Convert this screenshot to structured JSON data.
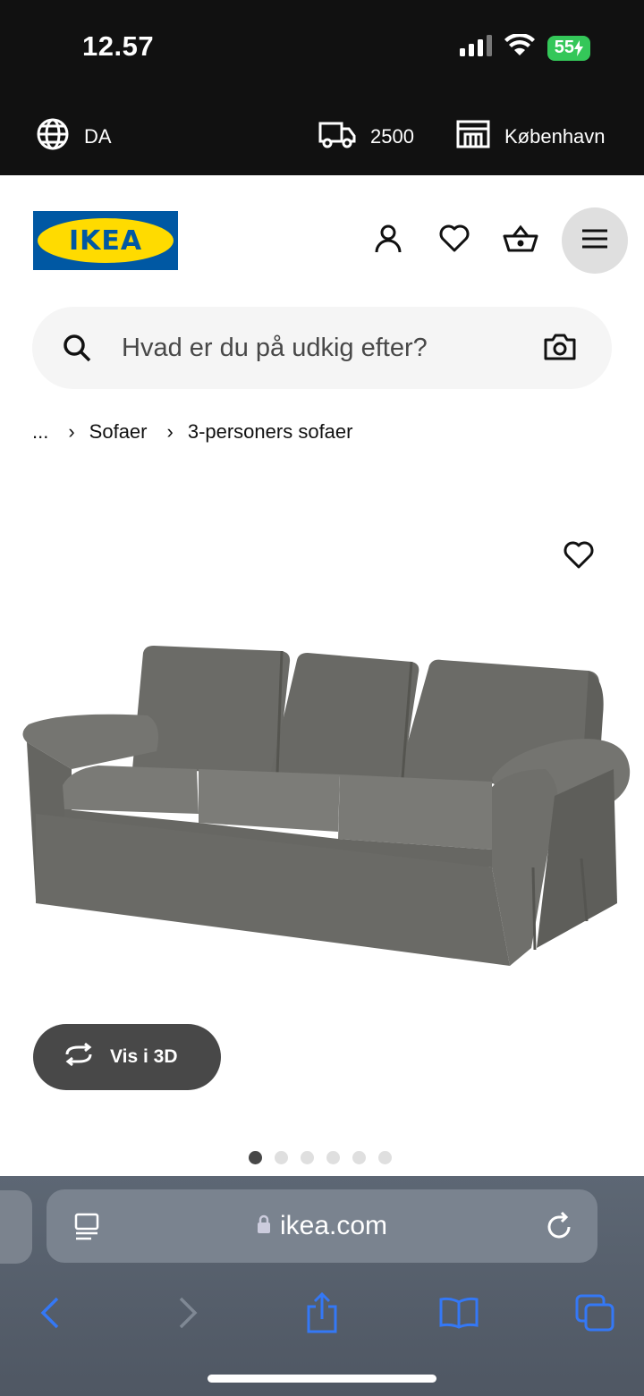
{
  "status_bar": {
    "time": "12.57",
    "battery": "55"
  },
  "info_bar": {
    "language": "DA",
    "postal_code": "2500",
    "store": "København"
  },
  "header": {
    "logo_text": "IKEA"
  },
  "search": {
    "placeholder": "Hvad er du på udkig efter?"
  },
  "breadcrumb": {
    "ellipsis": "...",
    "items": [
      "Sofaer",
      "3-personers sofaer"
    ]
  },
  "gallery": {
    "view_3d_label": "Vis i 3D",
    "image_count": 6,
    "current_image": 1
  },
  "browser": {
    "url": "ikea.com"
  },
  "colors": {
    "ikea_blue": "#0058a3",
    "ikea_yellow": "#ffdb00",
    "sofa_gray": "#6b6b67",
    "ios_blue": "#3478f6"
  },
  "icons": [
    "globe-icon",
    "truck-icon",
    "store-icon",
    "user-icon",
    "heart-icon",
    "basket-icon",
    "hamburger-menu-icon",
    "search-icon",
    "camera-icon",
    "rotate-3d-icon",
    "lock-icon",
    "reader-icon",
    "reload-icon",
    "back-icon",
    "forward-icon",
    "share-icon",
    "bookmarks-icon",
    "tabs-icon"
  ]
}
